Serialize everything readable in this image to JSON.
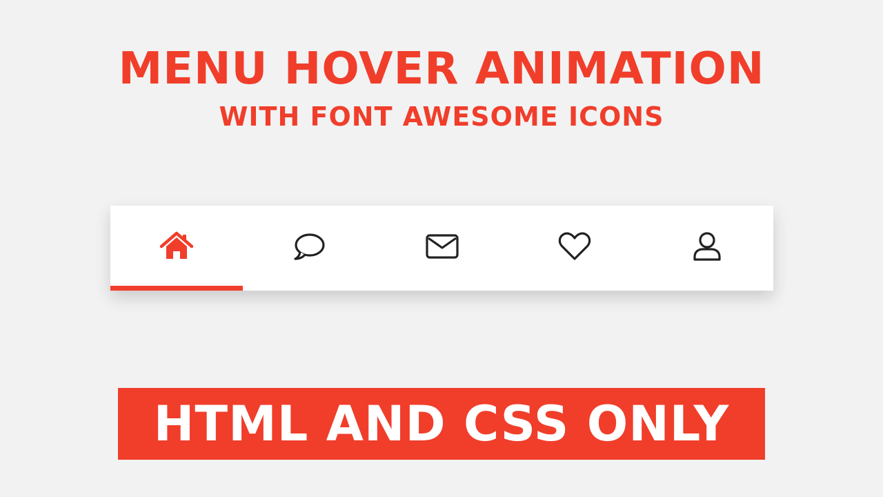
{
  "header": {
    "title": "MENU HOVER ANIMATION",
    "subtitle": "WITH FONT AWESOME ICONS"
  },
  "menu": {
    "items": [
      {
        "icon": "home-icon",
        "active": true
      },
      {
        "icon": "chat-bubble-icon",
        "active": false
      },
      {
        "icon": "envelope-icon",
        "active": false
      },
      {
        "icon": "heart-icon",
        "active": false
      },
      {
        "icon": "user-icon",
        "active": false
      }
    ]
  },
  "banner": {
    "text": "HTML AND CSS ONLY"
  },
  "colors": {
    "accent": "#f03e2b",
    "icon": "#222222",
    "background": "#f2f2f2",
    "menu_background": "#ffffff"
  }
}
